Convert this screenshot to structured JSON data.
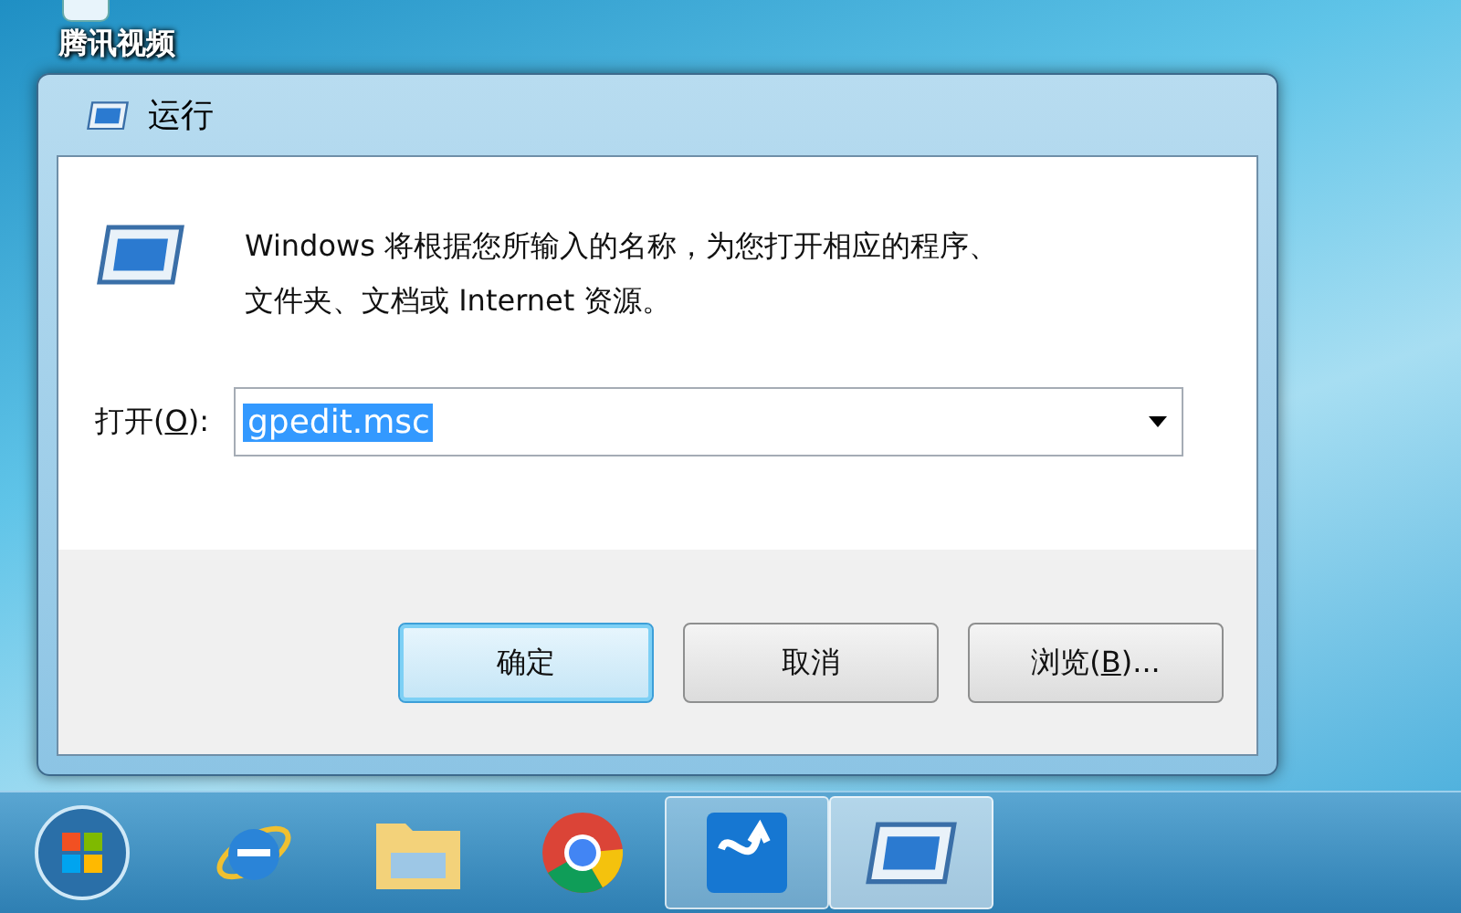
{
  "desktop": {
    "icon_label": "腾讯视频"
  },
  "dialog": {
    "title": "运行",
    "message_line_1": "Windows 将根据您所输入的名称，为您打开相应的程序、",
    "message_line_2": "文件夹、文档或 Internet 资源。",
    "open_label": {
      "before": "打开(",
      "mnemonic": "O",
      "after": "):"
    },
    "open_value": "gpedit.msc",
    "buttons": [
      {
        "before": "确定",
        "selected": true
      },
      {
        "before": "取消",
        "selected": false
      },
      {
        "before": "浏览(",
        "mnemonic": "B",
        "after": ")...",
        "selected": false
      }
    ]
  },
  "taskbar": {
    "items": [
      {
        "kind": "ie",
        "running": false,
        "selected": false
      },
      {
        "kind": "folder",
        "running": false,
        "selected": false
      },
      {
        "kind": "chrome",
        "running": false,
        "selected": false
      },
      {
        "kind": "app",
        "running": true,
        "selected": false
      },
      {
        "kind": "run",
        "running": true,
        "selected": true
      }
    ]
  }
}
